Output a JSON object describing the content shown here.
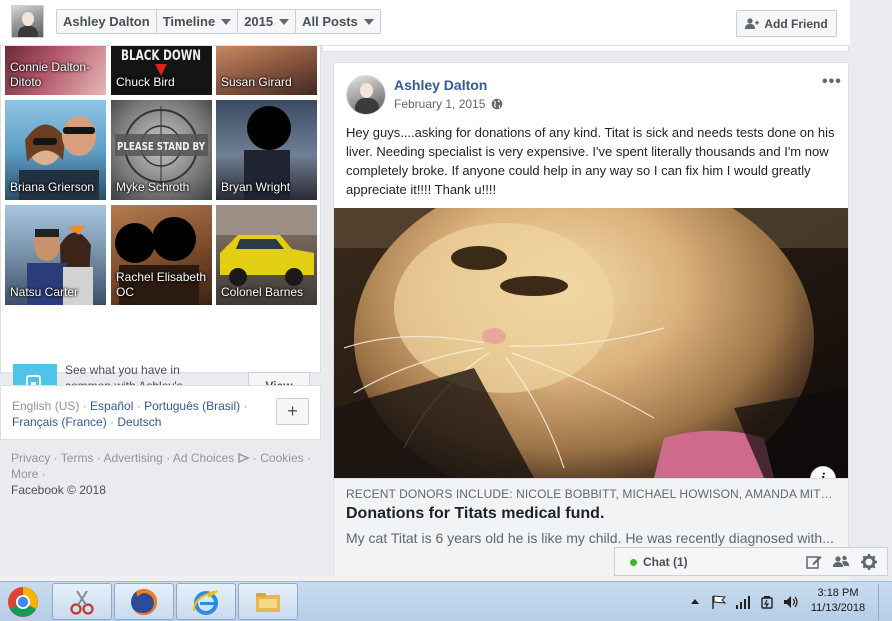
{
  "topbar": {
    "breadcrumbs": [
      {
        "label": "Ashley Dalton",
        "has_caret": false
      },
      {
        "label": "Timeline",
        "has_caret": true
      },
      {
        "label": "2015",
        "has_caret": true
      },
      {
        "label": "All Posts",
        "has_caret": true
      }
    ],
    "add_friend_label": "Add Friend",
    "add_friend_icon": "add-friend-icon"
  },
  "friends": {
    "tiles": [
      {
        "name": "Connie Dalton-Ditoto"
      },
      {
        "name": "Chuck Bird"
      },
      {
        "name": "Susan Girard"
      },
      {
        "name": "Briana Grierson"
      },
      {
        "name": "Myke Schroth"
      },
      {
        "name": "Bryan Wright"
      },
      {
        "name": "Natsu Carter"
      },
      {
        "name": "Rachel Elisabeth OC"
      },
      {
        "name": "Colonel Barnes"
      }
    ],
    "tile_art_text": {
      "chuck": "BLACK DOWN",
      "myke": "PLEASE STAND BY"
    },
    "mutual_text": "See what you have in common with Ashley's friends.",
    "view_label": "View"
  },
  "languages": {
    "current": "English (US)",
    "links": [
      "Español",
      "Português (Brasil)",
      "Français (France)",
      "Deutsch"
    ],
    "plus_label": "+"
  },
  "footer": {
    "links": [
      "Privacy",
      "Terms",
      "Advertising",
      "Ad Choices",
      "Cookies",
      "More"
    ],
    "copyright": "Facebook © 2018"
  },
  "post": {
    "author": "Ashley Dalton",
    "date": "February 1, 2015",
    "privacy_icon": "globe-icon",
    "more_label": "•••",
    "text": "Hey guys....asking for donations of any kind. Titat is sick and needs tests done on his liver. Needing specialist is very expensive. I've spent literally thousands and I'm now completely broke. If anyone could help in any way so I can fix him I would greatly appreciate it!!!! Thank u!!!!",
    "info_label": "i",
    "link": {
      "caption": "RECENT DONORS INCLUDE: NICOLE BOBBITT, MICHAEL HOWISON, AMANDA MITC...",
      "title": "Donations for Titats medical fund.",
      "description": "My cat Titat is 6 years old he is like my child. He was recently diagnosed with..."
    }
  },
  "chat": {
    "label": "Chat (1)",
    "status_color": "#42b72a"
  },
  "taskbar": {
    "time": "3:18 PM",
    "date": "11/13/2018"
  },
  "colors": {
    "fb_link": "#365899",
    "background": "#e9ebee",
    "mutual_icon_bg": "#4fc3e8"
  }
}
